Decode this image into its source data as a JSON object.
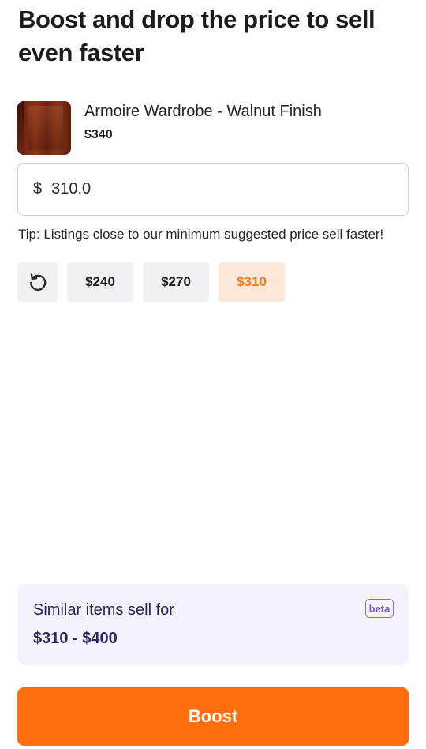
{
  "headline": "Boost and drop the price to sell even faster",
  "item": {
    "title": "Armoire Wardrobe - Walnut Finish",
    "price": "$340"
  },
  "price_input": {
    "currency": "$",
    "value": "310.0"
  },
  "tip": "Tip: Listings close to our minimum suggested price sell faster!",
  "chips": {
    "reset_icon": "reset-icon",
    "options": [
      "$240",
      "$270",
      "$310"
    ],
    "selected": "$310"
  },
  "similar": {
    "label": "Similar items sell for",
    "range": "$310 - $400",
    "badge": "beta"
  },
  "boost_button": "Boost",
  "colors": {
    "accent": "#ff6f0f",
    "selected_chip_bg": "#fde8d8",
    "selected_chip_text": "#f07a1e",
    "similar_bg": "#f4f2fd",
    "similar_text": "#2f2560"
  }
}
